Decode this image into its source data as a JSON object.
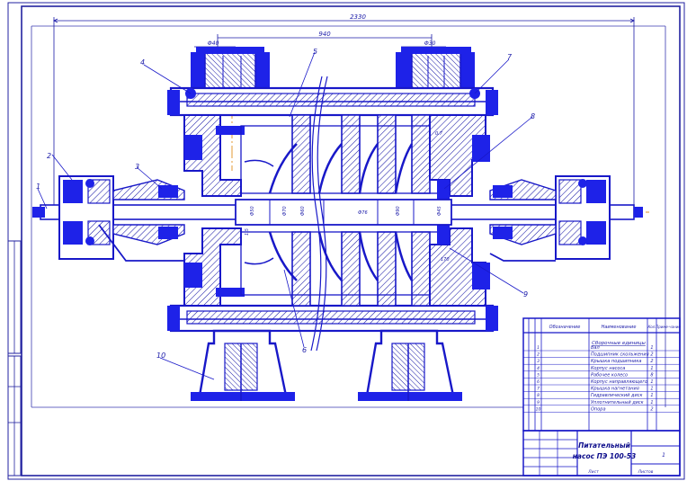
{
  "dimensions": {
    "overall_length": "2330",
    "between_flanges": "940",
    "inlet_flange": "Ф40",
    "outlet_flange": "Ф30",
    "shaft_d1": "Ф50",
    "shaft_d2": "Ф70",
    "shaft_d3": "Ф60",
    "shaft_d4": "Ф76",
    "shaft_d5": "Ф90",
    "shaft_d6": "Ф45",
    "dim_small1": "0.7",
    "dim_small2": "1.5",
    "dim_small3": "170"
  },
  "callouts": [
    "1",
    "2",
    "3",
    "4",
    "5",
    "6",
    "7",
    "8",
    "9",
    "10"
  ],
  "spec_table": {
    "headers": [
      "Обозначение",
      "Наименование",
      "Кол.",
      "Приме-чание"
    ],
    "section_title": "Сборочные единицы",
    "rows": [
      "Вал",
      "Подшипник скольжения",
      "Крышка подшипника",
      "Корпус насоса",
      "Рабочее колесо",
      "Корпус направляющего",
      "Крышка нагнетания",
      "Гидравлический диск",
      "Уплотнительный диск",
      "Опора"
    ],
    "qty": [
      "1",
      "2",
      "2",
      "1",
      "8",
      "1",
      "1",
      "1",
      "1",
      "2"
    ]
  },
  "title_block": {
    "title_line1": "Питательный",
    "title_line2": "насос ПЭ 100-53",
    "sheet_label": "Лист",
    "sheets_label": "Листов",
    "sheet_num": "1"
  },
  "colors": {
    "line": "#1818c8",
    "fill": "#1e22e8",
    "hatch": "#1a1aa8",
    "center": "#e09020",
    "frame": "#2222a0",
    "bg": "#ffffff"
  }
}
